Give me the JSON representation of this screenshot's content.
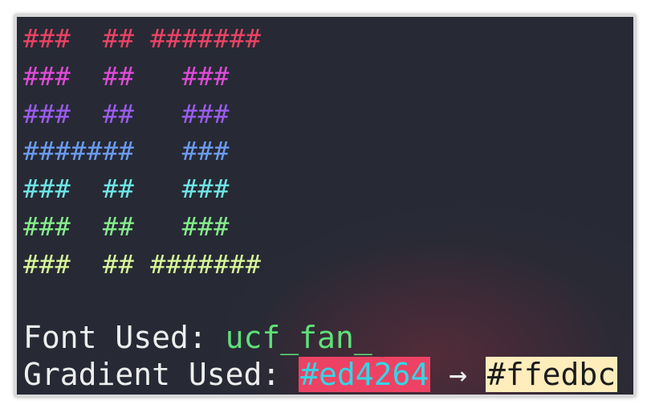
{
  "ascii_art": [
    {
      "text": "###  ## #######",
      "color": "#ed4264"
    },
    {
      "text": "###  ##   ###",
      "color": "#e04ad9"
    },
    {
      "text": "###  ##   ###",
      "color": "#9b5cf0"
    },
    {
      "text": "#######   ###",
      "color": "#6c9cf2"
    },
    {
      "text": "###  ##   ###",
      "color": "#6ee6e6"
    },
    {
      "text": "###  ##   ###",
      "color": "#86ec8c"
    },
    {
      "text": "###  ## #######",
      "color": "#d8f59a"
    }
  ],
  "info": {
    "font_label": "Font Used: ",
    "font_name": "ucf_fan_",
    "gradient_label": "Gradient Used: ",
    "gradient_start": "#ed4264",
    "arrow": " → ",
    "gradient_end": "#ffedbc"
  }
}
